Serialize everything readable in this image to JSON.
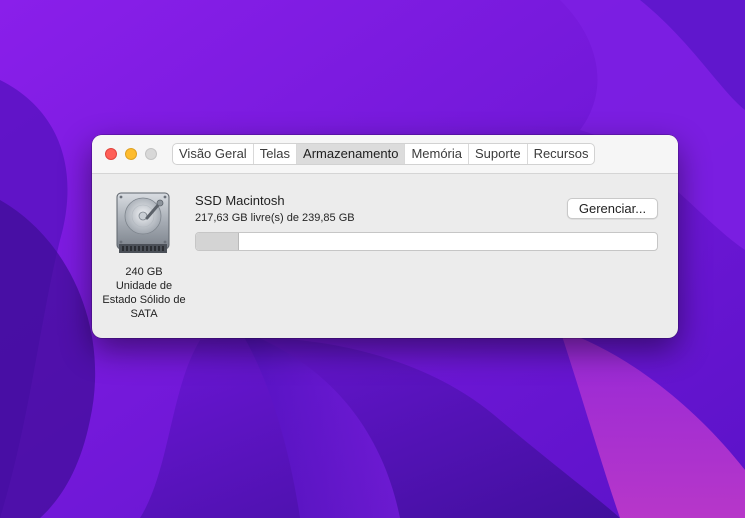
{
  "window": {
    "tabs": [
      {
        "label": "Visão Geral",
        "active": false
      },
      {
        "label": "Telas",
        "active": false
      },
      {
        "label": "Armazenamento",
        "active": true
      },
      {
        "label": "Memória",
        "active": false
      },
      {
        "label": "Suporte",
        "active": false
      },
      {
        "label": "Recursos",
        "active": false
      }
    ]
  },
  "drive": {
    "icon": "hard-drive-icon",
    "caption_lines": [
      "240 GB",
      "Unidade de",
      "Estado Sólido de",
      "SATA"
    ]
  },
  "volume": {
    "name": "SSD Macintosh",
    "free_text": "217,63 GB livre(s) de 239,85 GB",
    "manage_label": "Gerenciar...",
    "used_fraction": 0.0926
  },
  "colors": {
    "close": "#ff5f57",
    "minimize": "#febc2e",
    "zoom_disabled": "#d8d8d8",
    "wallpaper": "#6a12d8"
  }
}
